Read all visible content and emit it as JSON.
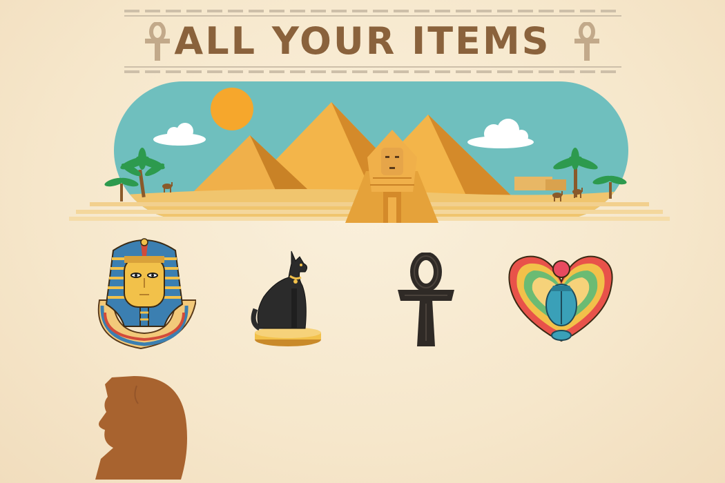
{
  "header": {
    "title": "ALL YOUR ITEMS"
  },
  "colors": {
    "title": "#8a623c",
    "sky": "#6fbfbe",
    "sand": "#f0c56e",
    "pyramid": "#e5a23a",
    "locked_item": "#a8632f"
  },
  "items": [
    {
      "name": "pharaoh-mask",
      "state": "collected"
    },
    {
      "name": "bastet-cat",
      "state": "collected"
    },
    {
      "name": "ankh",
      "state": "collected"
    },
    {
      "name": "scarab",
      "state": "collected"
    },
    {
      "name": "queen-head",
      "state": "locked"
    }
  ]
}
